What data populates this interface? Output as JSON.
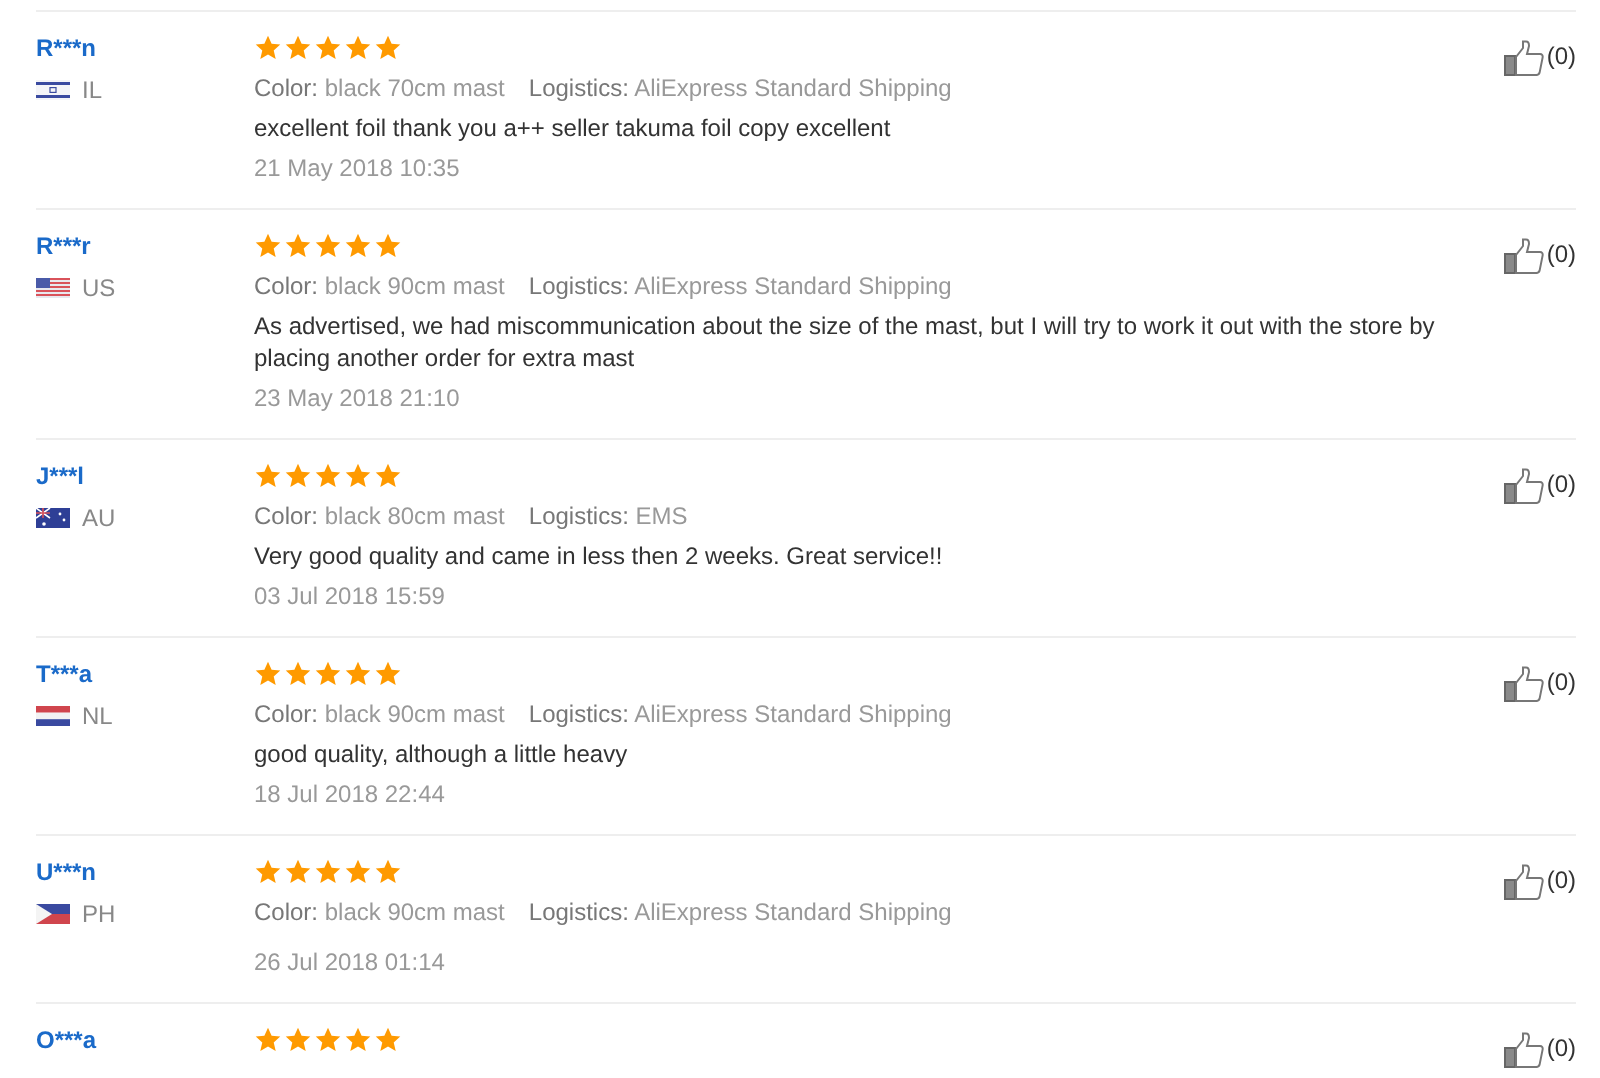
{
  "reviews": [
    {
      "name": "R***n",
      "flag": {
        "kind": "israel"
      },
      "country": "IL",
      "stars": 5,
      "variant_label": "Color:",
      "variant": "black 70cm mast",
      "logistics_label": "Logistics:",
      "logistics": "AliExpress Standard Shipping",
      "text": "excellent foil thank you a++ seller takuma foil copy excellent",
      "date": "21 May 2018 10:35",
      "likes": "(0)"
    },
    {
      "name": "R***r",
      "flag": {
        "kind": "usa"
      },
      "country": "US",
      "stars": 5,
      "variant_label": "Color:",
      "variant": "black 90cm mast",
      "logistics_label": "Logistics:",
      "logistics": "AliExpress Standard Shipping",
      "text": "As advertised, we had miscommunication about the size of the mast, but I will try to work it out with the store by placing another order for extra mast",
      "date": "23 May 2018 21:10",
      "likes": "(0)"
    },
    {
      "name": "J***l",
      "flag": {
        "kind": "australia"
      },
      "country": "AU",
      "stars": 5,
      "variant_label": "Color:",
      "variant": "black 80cm mast",
      "logistics_label": "Logistics:",
      "logistics": "EMS",
      "text": "Very good quality and came in less then 2 weeks. Great service!!",
      "date": "03 Jul 2018 15:59",
      "likes": "(0)"
    },
    {
      "name": "T***a",
      "flag": {
        "kind": "netherlands"
      },
      "country": "NL",
      "stars": 5,
      "variant_label": "Color:",
      "variant": "black 90cm mast",
      "logistics_label": "Logistics:",
      "logistics": "AliExpress Standard Shipping",
      "text": "good quality, although a little heavy",
      "date": "18 Jul 2018 22:44",
      "likes": "(0)"
    },
    {
      "name": "U***n",
      "flag": {
        "kind": "philippines"
      },
      "country": "PH",
      "stars": 5,
      "variant_label": "Color:",
      "variant": "black 90cm mast",
      "logistics_label": "Logistics:",
      "logistics": "AliExpress Standard Shipping",
      "date": "26 Jul 2018 01:14",
      "likes": "(0)"
    },
    {
      "name": "O***a",
      "stars": 5,
      "likes": "(0)"
    }
  ]
}
